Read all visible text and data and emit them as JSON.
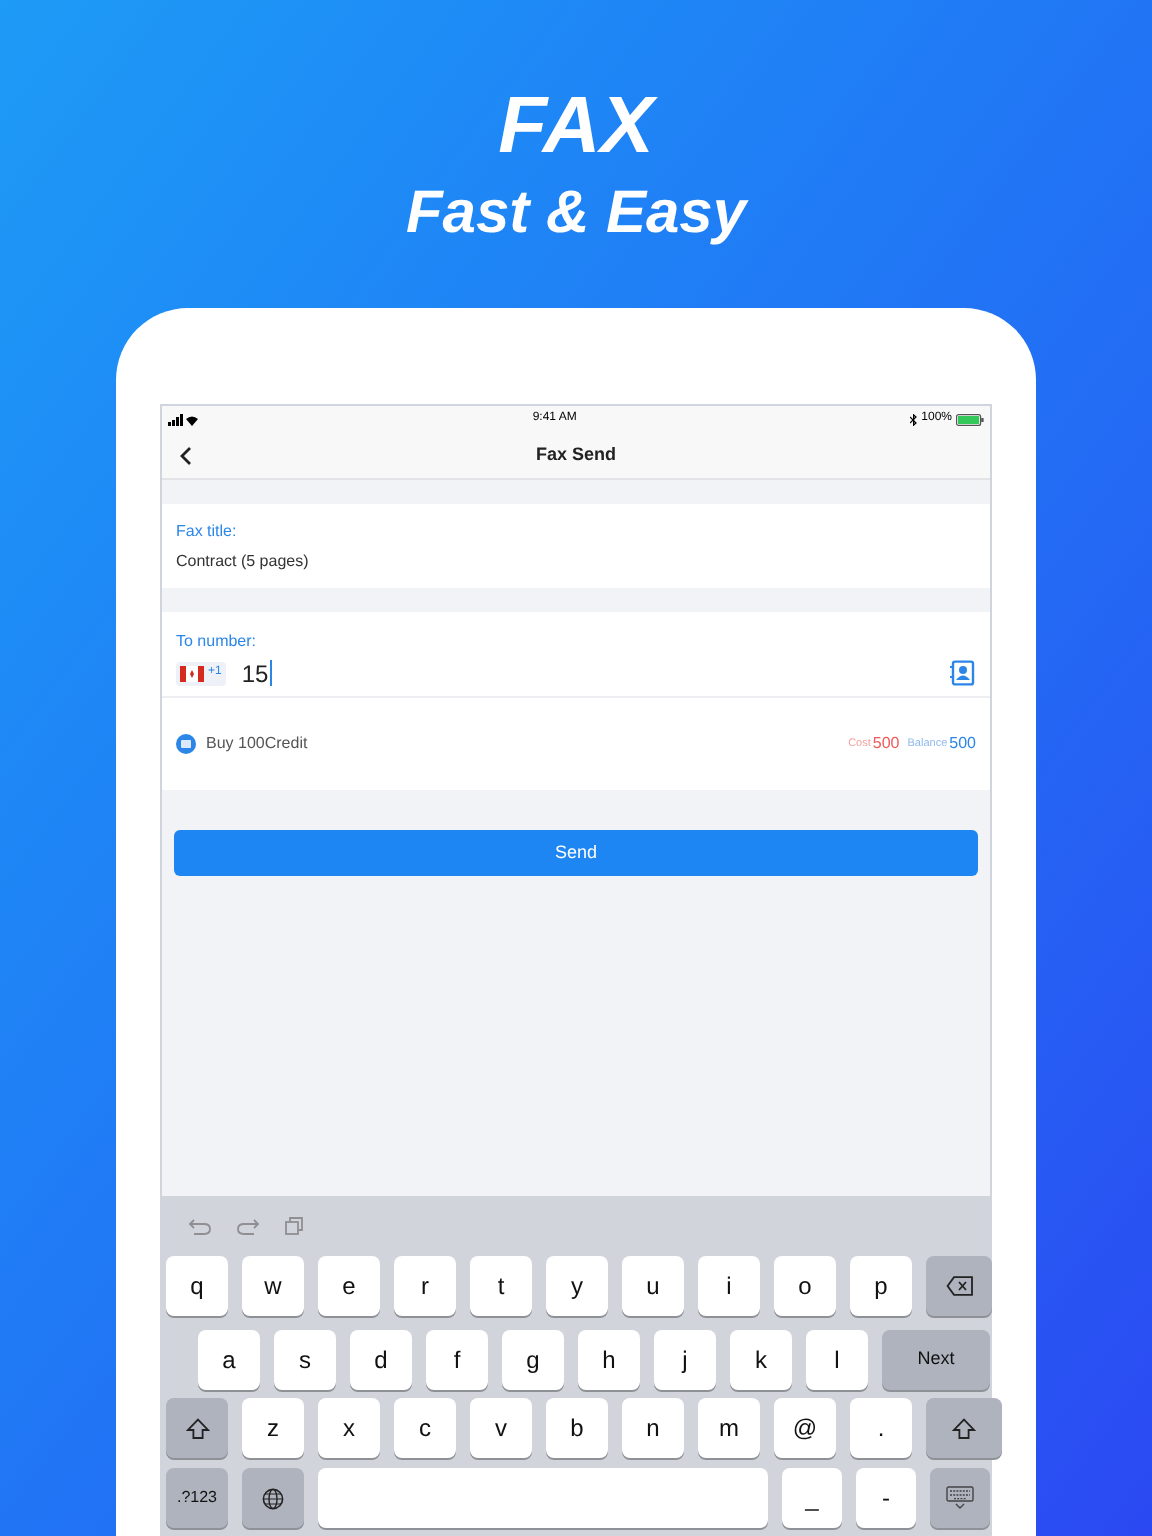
{
  "headline": {
    "title": "FAX",
    "subtitle": "Fast & Easy"
  },
  "status_bar": {
    "time": "9:41 AM",
    "battery": "100%"
  },
  "nav": {
    "title": "Fax Send"
  },
  "fax_title": {
    "label": "Fax title:",
    "value": "Contract (5 pages)"
  },
  "to_number": {
    "label": "To number:",
    "country_code": "+1",
    "value": "15"
  },
  "credit": {
    "label": "Buy 100Credit",
    "cost_label": "Cost",
    "cost": "500",
    "balance_label": "Balance",
    "balance": "500"
  },
  "send_button": "Send",
  "keyboard": {
    "rows": [
      [
        {
          "kind": "char",
          "label": "q"
        },
        {
          "kind": "char",
          "label": "w"
        },
        {
          "kind": "char",
          "label": "e"
        },
        {
          "kind": "char",
          "label": "r"
        },
        {
          "kind": "char",
          "label": "t"
        },
        {
          "kind": "char",
          "label": "y"
        },
        {
          "kind": "char",
          "label": "u"
        },
        {
          "kind": "char",
          "label": "i"
        },
        {
          "kind": "char",
          "label": "o"
        },
        {
          "kind": "char",
          "label": "p"
        },
        {
          "kind": "backspace"
        }
      ],
      [
        {
          "kind": "char",
          "label": "a"
        },
        {
          "kind": "char",
          "label": "s"
        },
        {
          "kind": "char",
          "label": "d"
        },
        {
          "kind": "char",
          "label": "f"
        },
        {
          "kind": "char",
          "label": "g"
        },
        {
          "kind": "char",
          "label": "h"
        },
        {
          "kind": "char",
          "label": "j"
        },
        {
          "kind": "char",
          "label": "k"
        },
        {
          "kind": "char",
          "label": "l"
        },
        {
          "kind": "action",
          "label": "Next"
        }
      ],
      [
        {
          "kind": "shift"
        },
        {
          "kind": "char",
          "label": "z"
        },
        {
          "kind": "char",
          "label": "x"
        },
        {
          "kind": "char",
          "label": "c"
        },
        {
          "kind": "char",
          "label": "v"
        },
        {
          "kind": "char",
          "label": "b"
        },
        {
          "kind": "char",
          "label": "n"
        },
        {
          "kind": "char",
          "label": "m"
        },
        {
          "kind": "char",
          "label": "@"
        },
        {
          "kind": "char",
          "label": "."
        },
        {
          "kind": "shift"
        }
      ],
      [
        {
          "kind": "action",
          "label": ".?123"
        },
        {
          "kind": "globe"
        },
        {
          "kind": "space"
        },
        {
          "kind": "char",
          "label": "_"
        },
        {
          "kind": "char",
          "label": "-"
        },
        {
          "kind": "dismiss"
        }
      ]
    ]
  }
}
